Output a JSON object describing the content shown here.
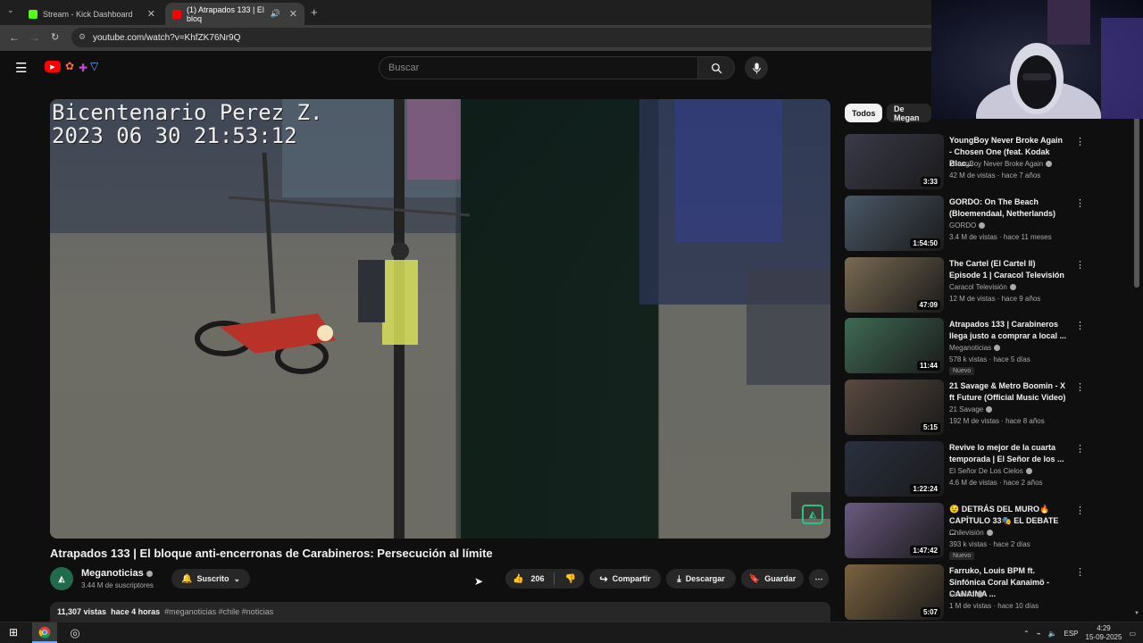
{
  "browser": {
    "tabs": [
      {
        "label": "Stream - Kick Dashboard",
        "favicon_color": "#53fc18"
      },
      {
        "label": "(1) Atrapados 133 | El bloq",
        "favicon_color": "#ff0000"
      }
    ],
    "url": "youtube.com/watch?v=KhfZK76Nr9Q"
  },
  "header": {
    "search_placeholder": "Buscar"
  },
  "video": {
    "osd_line1": "Bicentenario Perez Z.",
    "osd_line2": "2023 06 30 21:53:12",
    "title": "Atrapados 133 | El bloque anti-encerronas de Carabineros: Persecución al límite",
    "channel": "Meganoticias",
    "subscribers": "3.44 M de suscriptores",
    "subscribe_label": "Suscrito",
    "likes": "206",
    "share_label": "Compartir",
    "download_label": "Descargar",
    "save_label": "Guardar",
    "views": "11,307 vistas",
    "age": "hace 4 horas",
    "hashtags": "#meganoticias #chile #noticias"
  },
  "chips": [
    "Todos",
    "De Megan"
  ],
  "recommendations": [
    {
      "title": "YoungBoy Never Broke Again - Chosen One (feat. Kodak Blac...",
      "channel": "YoungBoy Never Broke Again",
      "views": "42 M de vistas",
      "age": "hace 7 años",
      "duration": "3:33",
      "thumb_color": "#3a3a4a",
      "badge": ""
    },
    {
      "title": "GORDO: On The Beach (Bloemendaal, Netherlands)",
      "channel": "GORDO",
      "views": "3.4 M de vistas",
      "age": "hace 11 meses",
      "duration": "1:54:50",
      "thumb_color": "#4a5868",
      "badge": ""
    },
    {
      "title": "The Cartel (El Cartel II) Episode 1 | Caracol Televisión",
      "channel": "Caracol Televisión",
      "views": "12 M de vistas",
      "age": "hace 9 años",
      "duration": "47:09",
      "thumb_color": "#7a6a52",
      "badge": ""
    },
    {
      "title": "Atrapados 133 | Carabineros llega justo a comprar a local ...",
      "channel": "Meganoticias",
      "views": "578 k vistas",
      "age": "hace 5 días",
      "duration": "11:44",
      "thumb_color": "#3f6a55",
      "badge": "Nuevo"
    },
    {
      "title": "21 Savage & Metro Boomin - X ft Future (Official Music Video)",
      "channel": "21 Savage",
      "views": "192 M de vistas",
      "age": "hace 8 años",
      "duration": "5:15",
      "thumb_color": "#5a4a40",
      "badge": ""
    },
    {
      "title": "Revive lo mejor de la cuarta temporada | El Señor de los ...",
      "channel": "El Señor De Los Cielos",
      "views": "4.6 M de vistas",
      "age": "hace 2 años",
      "duration": "1:22:24",
      "thumb_color": "#2a3040",
      "badge": ""
    },
    {
      "title": "😉 DETRÁS DEL MURO🔥 CAPÍTULO 33🎭 EL DEBATE ...",
      "channel": "Chilevisión",
      "views": "393 k vistas",
      "age": "hace 2 días",
      "duration": "1:47:42",
      "thumb_color": "#6a5a80",
      "badge": "Nuevo"
    },
    {
      "title": "Farruko, Louis BPM ft. Sinfónica Coral Kanaimö - CANAIMA ...",
      "channel": "Farruko",
      "views": "1 M de vistas",
      "age": "hace 10 días",
      "duration": "5:07",
      "thumb_color": "#7a6240",
      "badge": ""
    }
  ],
  "taskbar": {
    "lang": "ESP",
    "time": "4:29",
    "date": "15-09-2025"
  }
}
